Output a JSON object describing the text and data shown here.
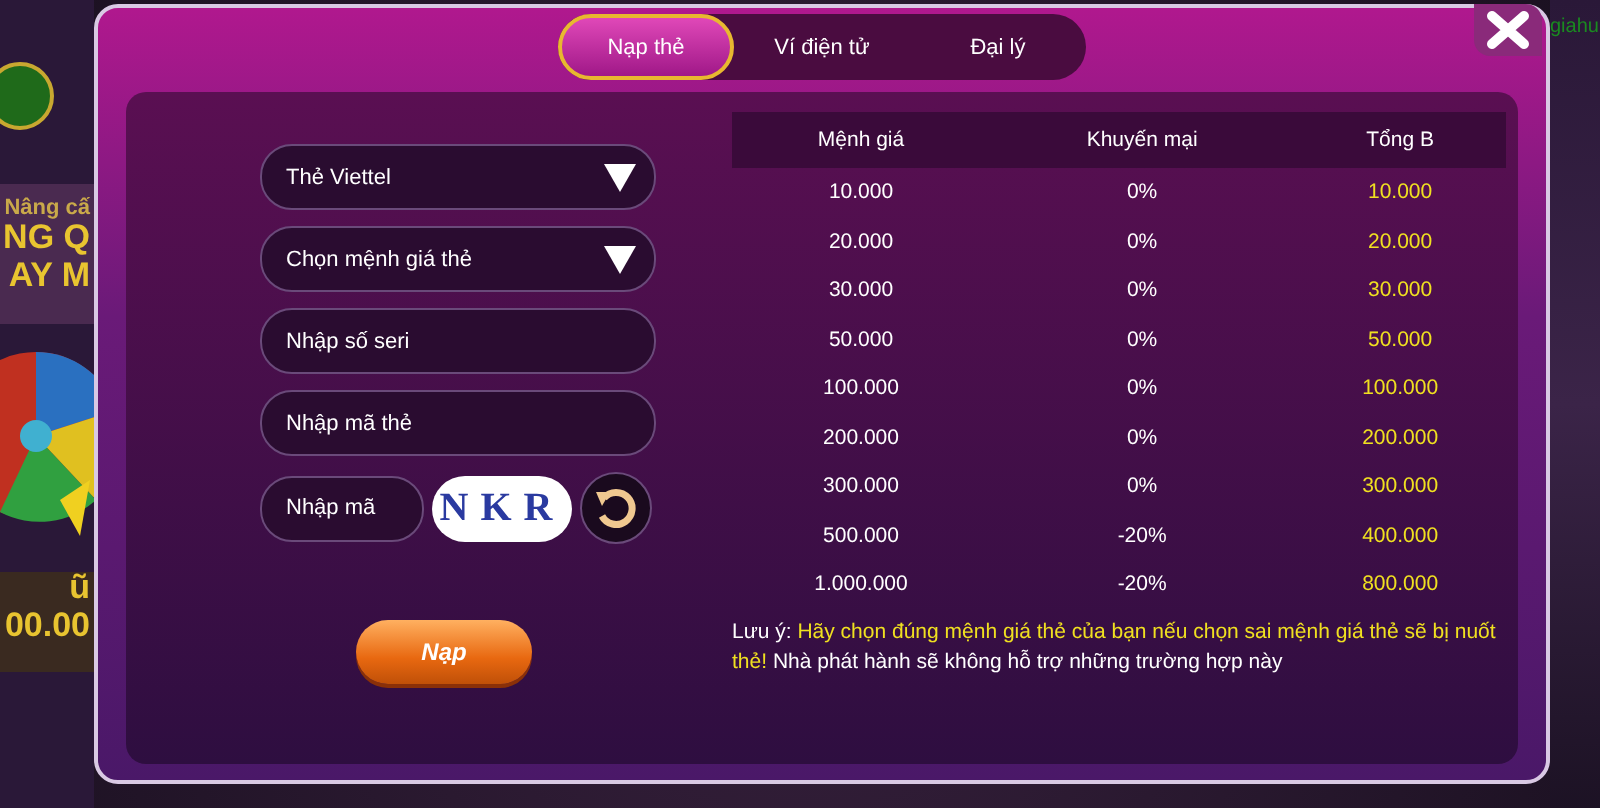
{
  "background": {
    "texts": [
      {
        "text": "Nâng cấ",
        "kind": "small"
      },
      {
        "text": "NG Q",
        "kind": "big"
      },
      {
        "text": "AY M",
        "kind": "big"
      }
    ],
    "bottom_texts": [
      {
        "text": "ũ",
        "kind": "big"
      },
      {
        "text": "00.00",
        "kind": "big"
      }
    ],
    "corner_text": "giahu"
  },
  "tabs": [
    {
      "label": "Nạp thẻ",
      "selected": true
    },
    {
      "label": "Ví điện tử",
      "selected": false
    },
    {
      "label": "Đại lý",
      "selected": false
    }
  ],
  "form": {
    "fields": [
      {
        "kind": "select",
        "value": "Thẻ Viettel"
      },
      {
        "kind": "select",
        "placeholder": "Chọn mệnh giá thẻ"
      },
      {
        "kind": "input",
        "placeholder": "Nhập số seri"
      },
      {
        "kind": "input",
        "placeholder": "Nhập mã thẻ"
      }
    ],
    "captcha_field": {
      "placeholder": "Nhập mã"
    },
    "captcha": "NKR",
    "submit": "Nạp"
  },
  "table": {
    "columns": [
      "Mệnh giá",
      "Khuyến mại",
      "Tổng B"
    ],
    "rows": [
      [
        "10.000",
        "0%",
        "10.000"
      ],
      [
        "20.000",
        "0%",
        "20.000"
      ],
      [
        "30.000",
        "0%",
        "30.000"
      ],
      [
        "50.000",
        "0%",
        "50.000"
      ],
      [
        "100.000",
        "0%",
        "100.000"
      ],
      [
        "200.000",
        "0%",
        "200.000"
      ],
      [
        "300.000",
        "0%",
        "300.000"
      ],
      [
        "500.000",
        "-20%",
        "400.000"
      ],
      [
        "1.000.000",
        "-20%",
        "800.000"
      ]
    ]
  },
  "note": [
    {
      "text": "Lưu ý:",
      "highlight": false
    },
    {
      "text": "Hãy chọn đúng mệnh giá thẻ của bạn nếu chọn sai mệnh giá thẻ sẽ bị nuốt thẻ!",
      "highlight": true
    },
    {
      "text": "Nhà phát hành sẽ không hỗ trợ những trường hợp này",
      "highlight": false
    }
  ]
}
